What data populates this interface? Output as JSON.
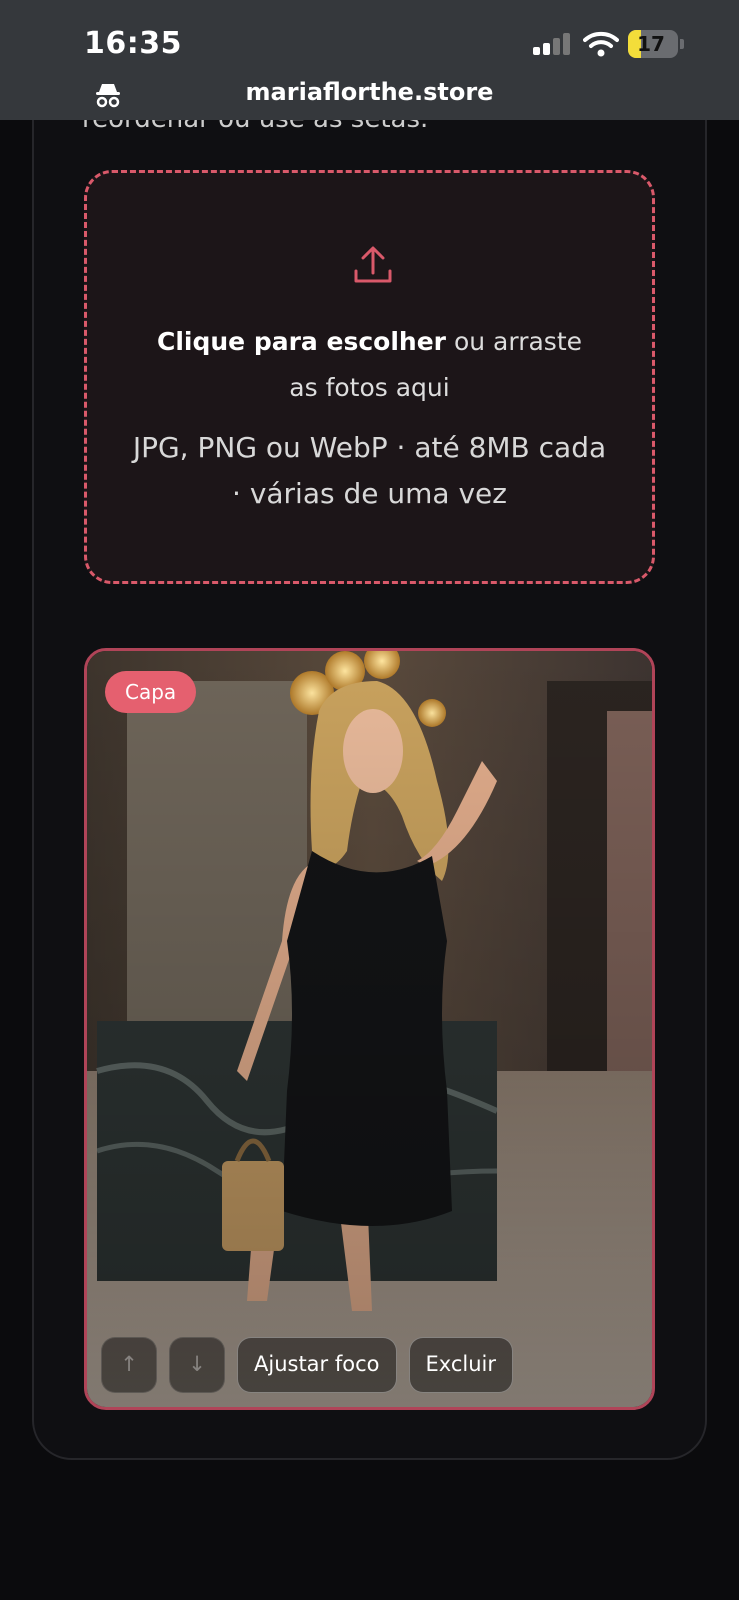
{
  "status_bar": {
    "time": "16:35",
    "battery": "17",
    "battery_color": "#f3dd3a"
  },
  "browser": {
    "url": "mariaflorthe.store"
  },
  "partial_text": "reordenar ou use as setas.",
  "dropzone": {
    "cta_bold": "Clique para escolher",
    "cta_rest": " ou arraste as fotos aqui",
    "hint": "JPG, PNG ou WebP · até 8MB cada · várias de uma vez",
    "accent": "#d9596a"
  },
  "photo": {
    "badge": "Capa",
    "buttons": {
      "up": "↑",
      "down": "↓",
      "focus": "Ajustar foco",
      "delete": "Excluir"
    }
  }
}
